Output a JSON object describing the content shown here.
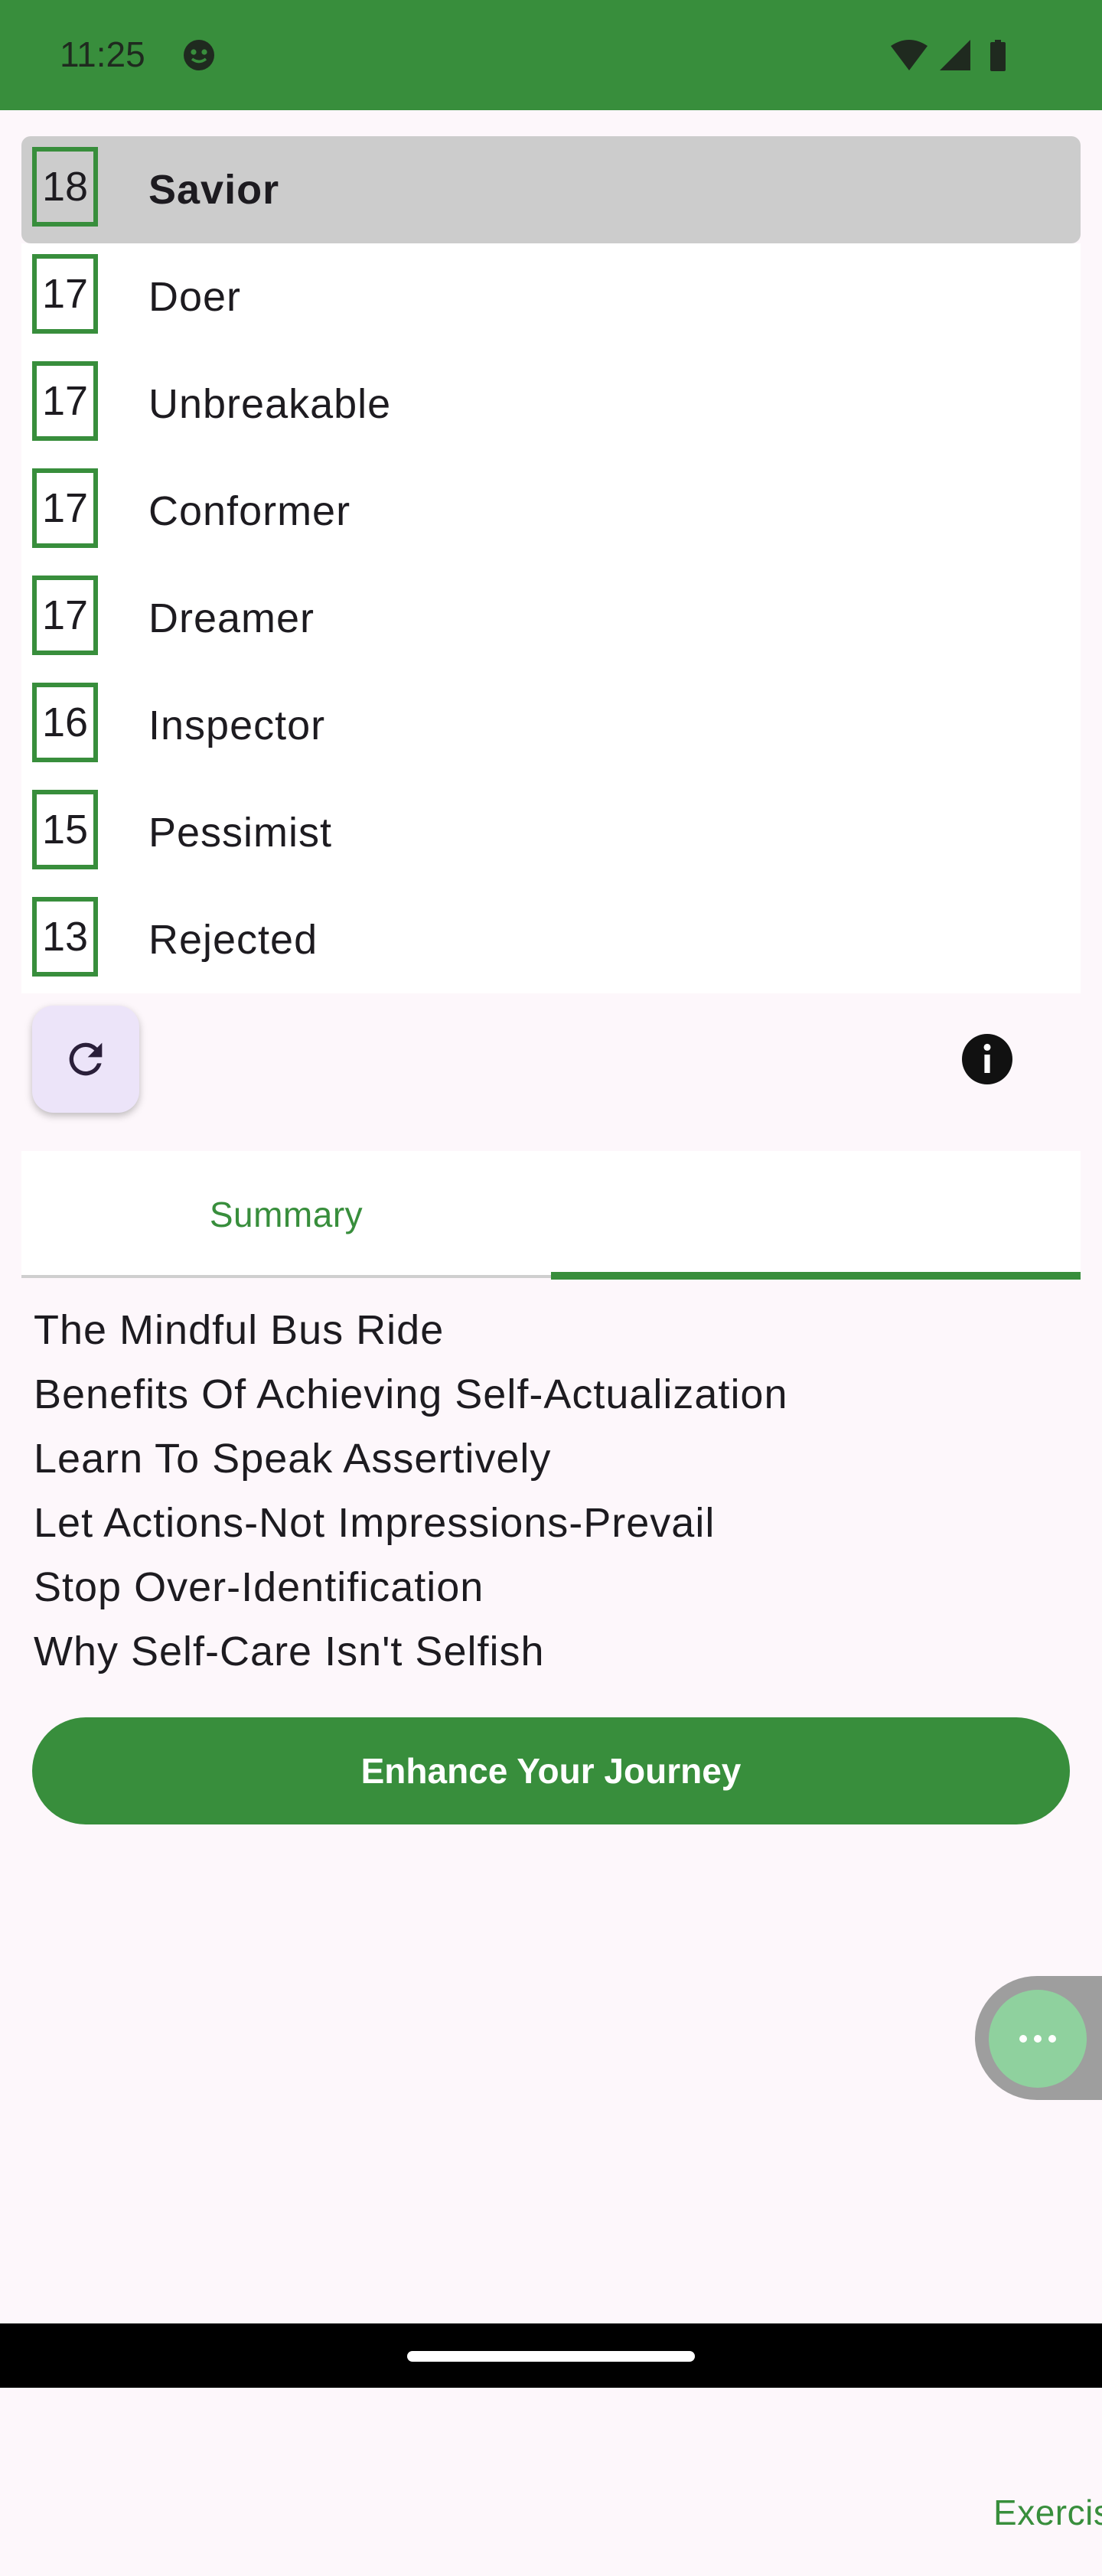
{
  "status_bar": {
    "time": "11:25",
    "icons": [
      "smiley-icon",
      "wifi-icon",
      "signal-icon",
      "battery-icon"
    ]
  },
  "traits": [
    {
      "score": "18",
      "label": "Savior",
      "selected": true
    },
    {
      "score": "17",
      "label": "Doer",
      "selected": false
    },
    {
      "score": "17",
      "label": "Unbreakable",
      "selected": false
    },
    {
      "score": "17",
      "label": "Conformer",
      "selected": false
    },
    {
      "score": "17",
      "label": "Dreamer",
      "selected": false
    },
    {
      "score": "16",
      "label": "Inspector",
      "selected": false
    },
    {
      "score": "15",
      "label": "Pessimist",
      "selected": false
    },
    {
      "score": "13",
      "label": "Rejected",
      "selected": false
    }
  ],
  "tabs": {
    "summary": "Summary",
    "exercises": "Exercises",
    "active": "exercises"
  },
  "exercises": [
    "The Mindful Bus Ride",
    "Benefits Of Achieving Self-Actualization",
    "Learn To Speak Assertively",
    "Let Actions-Not Impressions-Prevail",
    "Stop Over-Identification",
    "Why Self-Care Isn't Selfish"
  ],
  "cta_label": "Enhance Your Journey",
  "colors": {
    "brand_green": "#388e3c",
    "fab_background": "#ece4f9",
    "chat_green": "#8fd19e"
  }
}
